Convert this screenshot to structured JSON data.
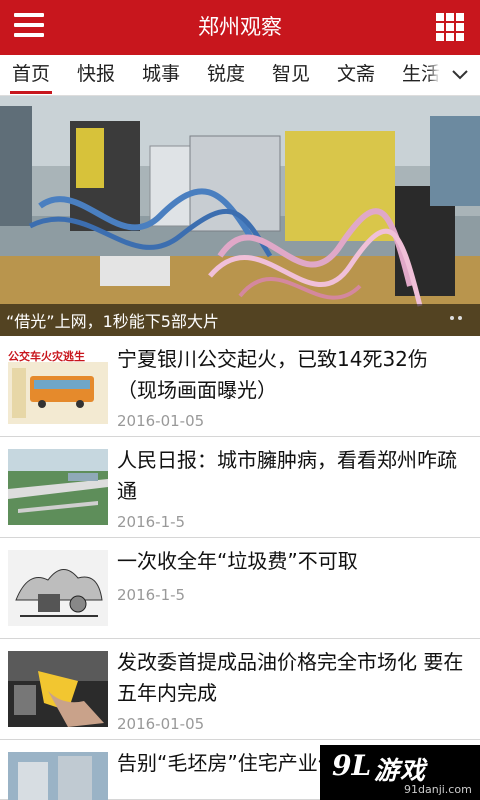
{
  "app": {
    "title": "郑州观察",
    "accent_color": "#c8161d",
    "menu_icon": "hamburger-icon",
    "apps_icon": "grid-icon"
  },
  "tabs": {
    "items": [
      {
        "label": "首页",
        "active": true
      },
      {
        "label": "快报",
        "active": false
      },
      {
        "label": "城事",
        "active": false
      },
      {
        "label": "锐度",
        "active": false
      },
      {
        "label": "智见",
        "active": false
      },
      {
        "label": "文斋",
        "active": false
      },
      {
        "label": "生活",
        "active": false
      }
    ],
    "more_icon": "chevron-down-icon"
  },
  "banner": {
    "caption": "“借光”上网，1秒能下5部大片",
    "page_dots": 2
  },
  "news": [
    {
      "headline": "宁夏银川公交起火，已致14死32伤（现场画面曝光）",
      "date": "2016-01-05",
      "thumb_text": "公交车火灾逃生"
    },
    {
      "headline": "人民日报：城市臃肿病，看看郑州咋疏通",
      "date": "2016-1-5"
    },
    {
      "headline": "一次收全年“垃圾费”不可取",
      "date": "2016-1-5"
    },
    {
      "headline": "发改委首提成品油价格完全市场化 要在五年内完成",
      "date": "2016-01-05"
    },
    {
      "headline": "告别“毛坯房”住宅产业化"
    }
  ],
  "watermark": {
    "logo_number": "9L",
    "logo_text": "游戏",
    "url": "91danji.com"
  }
}
